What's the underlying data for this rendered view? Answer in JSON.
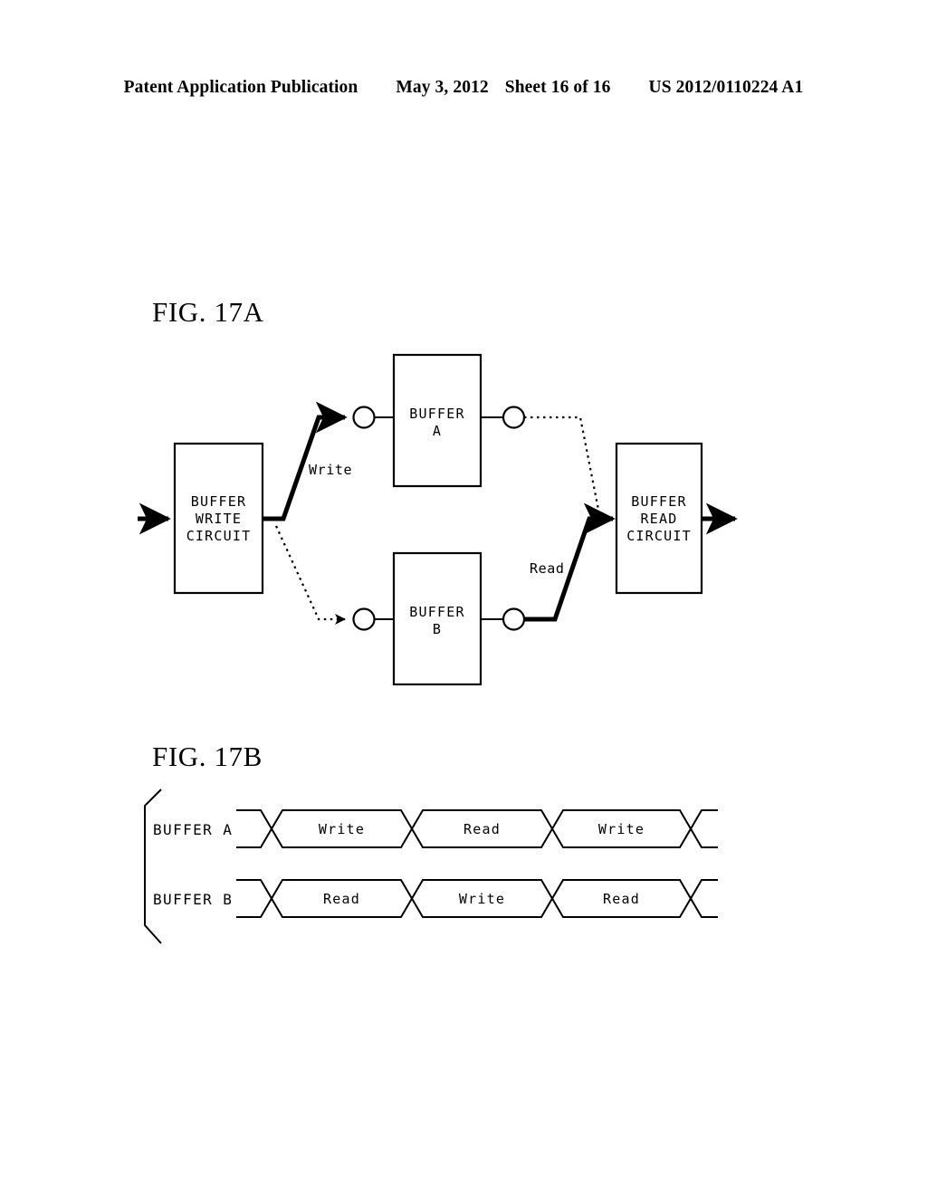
{
  "header": {
    "publication": "Patent Application Publication",
    "date": "May 3, 2012",
    "sheet": "Sheet 16 of 16",
    "patent_number": "US 2012/0110224 A1"
  },
  "figures": {
    "fig17a": {
      "caption": "FIG. 17A",
      "blocks": [
        {
          "id": "buffer_write_circuit",
          "lines": [
            "BUFFER",
            "WRITE",
            "CIRCUIT"
          ]
        },
        {
          "id": "buffer_a",
          "lines": [
            "BUFFER",
            "A"
          ]
        },
        {
          "id": "buffer_b",
          "lines": [
            "BUFFER",
            "B"
          ]
        },
        {
          "id": "buffer_read_circuit",
          "lines": [
            "BUFFER",
            "READ",
            "CIRCUIT"
          ]
        }
      ],
      "edge_labels": {
        "write": "Write",
        "read": "Read"
      }
    },
    "fig17b": {
      "caption": "FIG. 17B",
      "rows": [
        {
          "label": "BUFFER A",
          "segments": [
            "Write",
            "Read",
            "Write"
          ]
        },
        {
          "label": "BUFFER B",
          "segments": [
            "Read",
            "Write",
            "Read"
          ]
        }
      ]
    }
  },
  "colors": {
    "ink": "#000000",
    "paper": "#ffffff"
  }
}
